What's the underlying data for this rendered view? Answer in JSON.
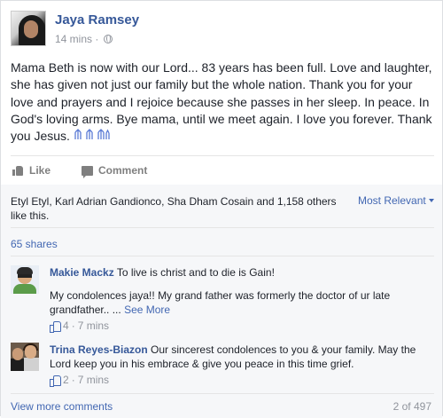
{
  "post": {
    "author": "Jaya Ramsey",
    "time": "14 mins",
    "time_separator": "·",
    "privacy_icon": "globe-icon",
    "text": "Mama Beth is now with our Lord... 83 years has been full. Love and laughter, she has given not just our family but the whole nation. Thank you for your love and prayers and I rejoice because she passes in her sleep. In peace. In God's loving arms. Bye mama, until we meet again. I love you forever. Thank you Jesus.",
    "emoji_icon": "praying-figures-icon"
  },
  "actions": {
    "like_label": "Like",
    "comment_label": "Comment"
  },
  "reactions": {
    "likers_text": "Etyl Etyl, Karl Adrian Gandionco, Sha Dham Cosain and 1,158 others like this.",
    "sort_label": "Most Relevant",
    "shares_label": "65 shares"
  },
  "comments": [
    {
      "name": "Makie Mackz",
      "text": "To live is christ and to die is Gain!",
      "reply_text": "My condolences jaya!! My grand father was formerly the doctor of ur late grandfather.. ...",
      "see_more": "See More",
      "likes": "4",
      "time": "7 mins",
      "separator": "·"
    },
    {
      "name": "Trina Reyes-Biazon",
      "text": "Our sincerest condolences to you & your family. May the Lord keep you in his embrace & give you peace in this time grief.",
      "likes": "2",
      "time": "7 mins",
      "separator": "·"
    }
  ],
  "footer": {
    "view_more_label": "View more comments",
    "count_label": "2 of 497"
  },
  "colors": {
    "link": "#4267b2",
    "name": "#365899",
    "meta": "#90949c",
    "reaction_bg": "#f6f7f9"
  }
}
